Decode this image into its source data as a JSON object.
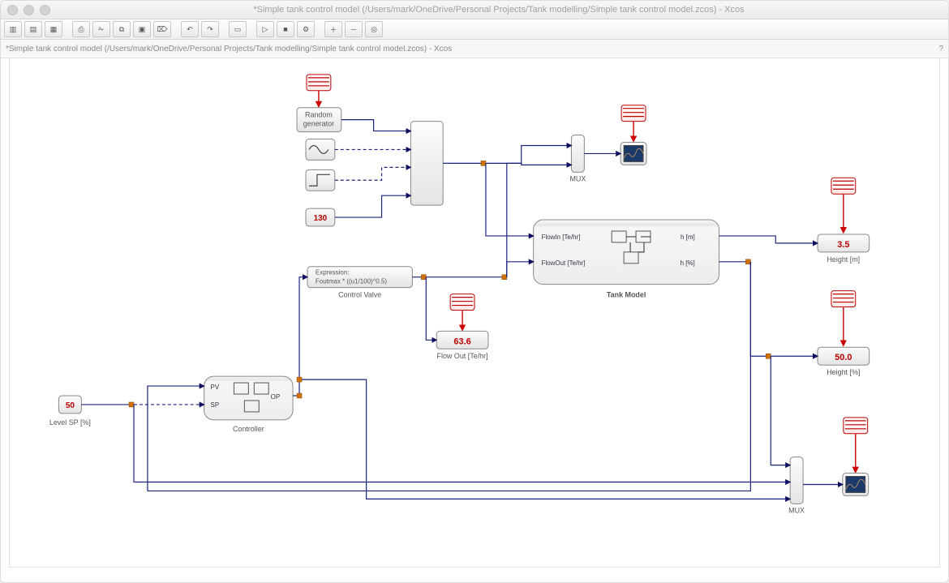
{
  "window": {
    "title": "*Simple tank control model (/Users/mark/OneDrive/Personal Projects/Tank modelling/Simple tank control model.zcos) - Xcos",
    "breadcrumb": "*Simple tank control model (/Users/mark/OneDrive/Personal Projects/Tank modelling/Simple tank control model.zcos) - Xcos",
    "help_hint": "?"
  },
  "toolbar": {
    "groups": [
      [
        "new",
        "open",
        "save"
      ],
      [
        "print",
        "cut",
        "copy",
        "paste",
        "delete"
      ],
      [
        "undo",
        "redo"
      ],
      [
        "fit-page"
      ],
      [
        "start",
        "stop",
        "setup"
      ],
      [
        "zoom-in",
        "zoom-out",
        "zoom-fit"
      ]
    ]
  },
  "blocks": {
    "random": {
      "label1": "Random",
      "label2": "generator"
    },
    "const130": {
      "value": "130"
    },
    "mux_top_label": "MUX",
    "mux_bot_label": "MUX",
    "tank": {
      "title": "Tank Model",
      "p_in_top": "FlowIn [Te/hr]",
      "p_in_bot": "FlowOut [Te/hr]",
      "p_out_top": "h [m]",
      "p_out_bot": "h [%]"
    },
    "expr": {
      "line1": "Expression:",
      "line2": "Foutmax * ((u1/100)^0.5)",
      "caption": "Control Valve"
    },
    "disp_flowout": {
      "value": "63.6",
      "caption": "Flow Out [Te/hr]"
    },
    "disp_hm": {
      "value": "3.5",
      "caption": "Height [m]"
    },
    "disp_hp": {
      "value": "50.0",
      "caption": "Height [%]"
    },
    "controller": {
      "title": "Controller",
      "p_pv": "PV",
      "p_sp": "SP",
      "p_op": "OP"
    },
    "const_sp": {
      "value": "50",
      "caption": "Level SP [%]"
    }
  }
}
